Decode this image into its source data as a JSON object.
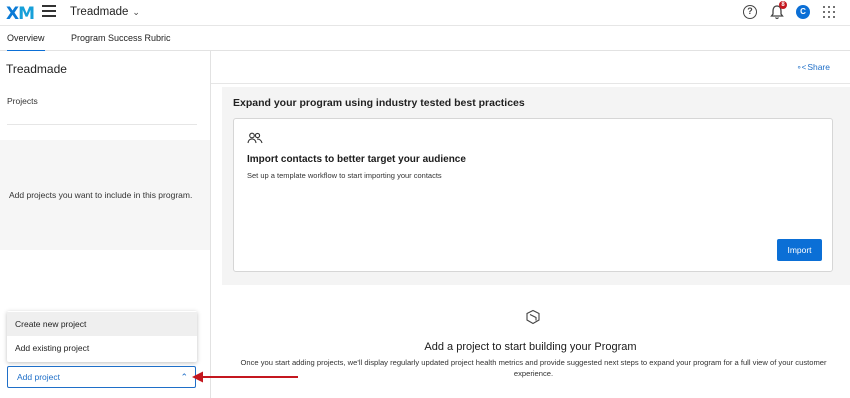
{
  "header": {
    "logo_x": "X",
    "logo_m": "M",
    "project_name": "Treadmade",
    "notification_count": "8",
    "avatar_initial": "C"
  },
  "tabs": [
    {
      "label": "Overview",
      "active": true
    },
    {
      "label": "Program Success Rubric",
      "active": false
    }
  ],
  "sidebar": {
    "title": "Treadmade",
    "projects_label": "Projects",
    "empty_text": "Add projects you want to include in this program.",
    "dropdown": [
      {
        "label": "Create new project"
      },
      {
        "label": "Add existing project"
      }
    ],
    "add_project_label": "Add project"
  },
  "main": {
    "share_label": "Share",
    "practices_title": "Expand your program using industry tested best practices",
    "card": {
      "title": "Import contacts to better target your audience",
      "subtitle": "Set up a template workflow to start importing your contacts",
      "button_label": "Import"
    },
    "empty_state": {
      "title": "Add a project to start building your Program",
      "description": "Once you start adding projects, we'll display regularly updated project health metrics and provide suggested next steps to expand your program for a full view of your customer experience."
    }
  },
  "colors": {
    "accent": "#0b6fd6",
    "annotation_arrow": "#c4171f"
  }
}
